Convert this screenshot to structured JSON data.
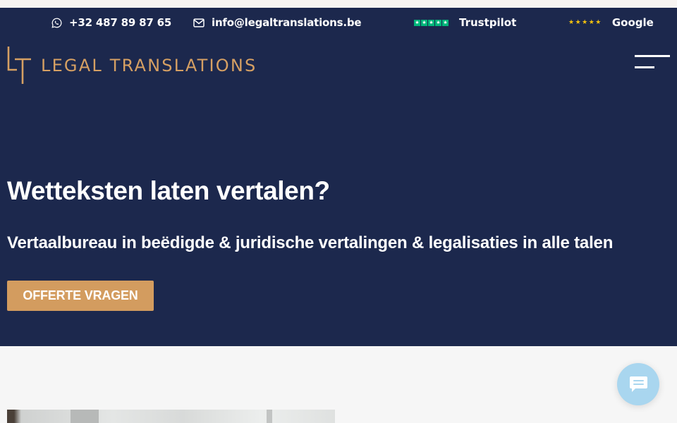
{
  "header": {
    "phone": "+32 487 89 87 65",
    "email": "info@legaltranslations.be",
    "ratings": [
      {
        "source": "Trustpilot",
        "stars": 5,
        "star_color": "#00b67a"
      },
      {
        "source": "Google",
        "stars": 5,
        "star_color": "#f4c20d"
      }
    ]
  },
  "logo": {
    "text": "LEGAL TRANSLATIONS",
    "mark": "LT"
  },
  "hero": {
    "title": "Wetteksten laten vertalen?",
    "subtitle": "Vertaalbureau in beëdigde & juridische vertalingen & legalisaties in alle talen",
    "cta_label": "OFFERTE VRAGEN"
  },
  "icons": {
    "phone": "whatsapp-icon",
    "email": "envelope-icon",
    "menu": "hamburger-menu-icon",
    "chat": "chat-bubble-icon"
  },
  "colors": {
    "navy": "#1c284d",
    "accent": "#d39c5f",
    "logo": "#d6a063",
    "chat": "#a9d6ef",
    "white": "#ffffff"
  }
}
